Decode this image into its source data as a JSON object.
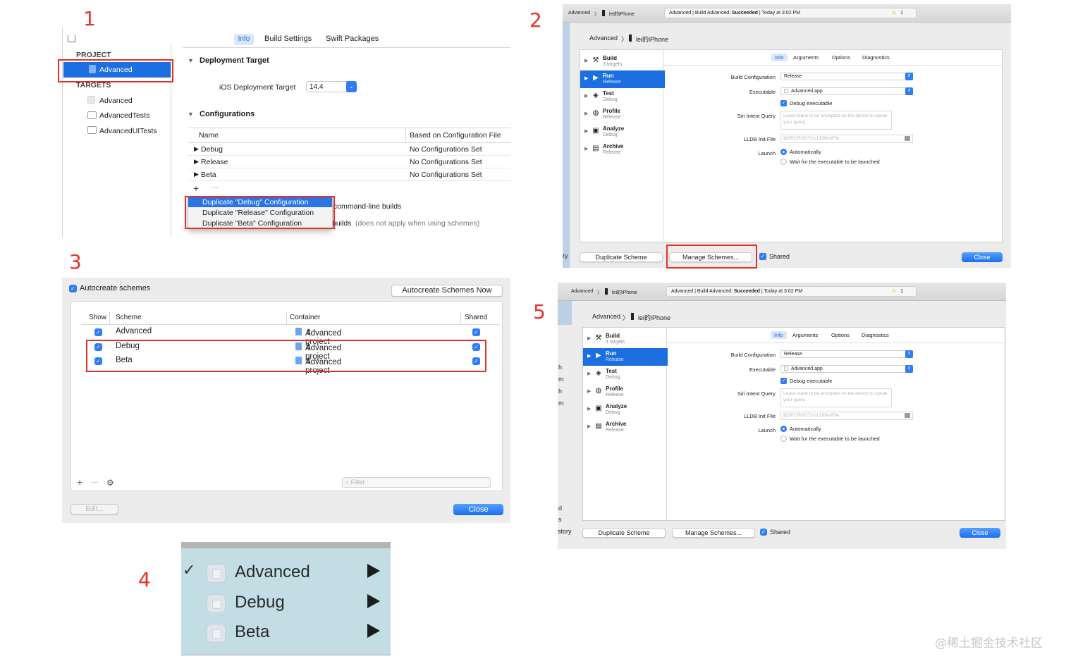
{
  "steps": {
    "s1": "1",
    "s2": "2",
    "s3": "3",
    "s4": "4",
    "s5": "5"
  },
  "panel1": {
    "tabs": [
      "Info",
      "Build Settings",
      "Swift Packages"
    ],
    "project_header": "PROJECT",
    "project_item": "Advanced",
    "targets_header": "TARGETS",
    "targets": [
      "Advanced",
      "AdvancedTests",
      "AdvancedUITests"
    ],
    "deployment_section": "Deployment Target",
    "deployment_label": "iOS Deployment Target",
    "deployment_value": "14.4",
    "configurations_section": "Configurations",
    "col_name": "Name",
    "col_based": "Based on Configuration File",
    "configs": [
      {
        "name": "Debug",
        "file": "No Configurations Set"
      },
      {
        "name": "Release",
        "file": "No Configurations Set"
      },
      {
        "name": "Beta",
        "file": "No Configurations Set"
      }
    ],
    "add": "+",
    "remove": "—",
    "menu": [
      "Duplicate \"Debug\" Configuration",
      "Duplicate \"Release\" Configuration",
      "Duplicate \"Beta\" Configuration"
    ],
    "behind_line1": "command-line builds",
    "behind_line2a": "builds",
    "behind_line2b": "(does not apply when using schemes)"
  },
  "scheme_editor": {
    "crumb_project": "Advanced",
    "crumb_device": "lei的iPhone",
    "status_prefix": "Advanced | Build Advanced: ",
    "status_bold": "Succeeded",
    "status_suffix": " | Today at 3:02 PM",
    "warning_count": "1",
    "actions": [
      {
        "t": "Build",
        "s": "3 targets"
      },
      {
        "t": "Run",
        "s": "Release"
      },
      {
        "t": "Test",
        "s": "Debug"
      },
      {
        "t": "Profile",
        "s": "Release"
      },
      {
        "t": "Analyze",
        "s": "Debug"
      },
      {
        "t": "Archive",
        "s": "Release"
      }
    ],
    "tabs": [
      "Info",
      "Arguments",
      "Options",
      "Diagnostics"
    ],
    "build_config_label": "Build Configuration",
    "build_config_value": "Release",
    "executable_label": "Executable",
    "executable_value": "Advanced.app",
    "debug_executable": "Debug executable",
    "siri_label": "Siri Intent Query",
    "siri_placeholder": "Leave blank to be prompted on the device to speak your query.",
    "lldb_label": "LLDB Init File",
    "lldb_placeholder": "$(SRCROOT)/.LLDBInitFile",
    "launch_label": "Launch",
    "launch_auto": "Automatically",
    "launch_wait": "Wait for the executable to be launched",
    "duplicate_btn": "Duplicate Scheme",
    "manage_btn": "Manage Schemes...",
    "shared": "Shared",
    "close": "Close"
  },
  "panel2_side": {
    "t1": "ry"
  },
  "panel5_side": {
    "letters": [
      "h",
      "m",
      "h",
      "m",
      "d",
      "s",
      "story"
    ]
  },
  "panel3": {
    "autocreate": "Autocreate schemes",
    "autocreate_now": "Autocreate Schemes Now",
    "cols": {
      "show": "Show",
      "scheme": "Scheme",
      "container": "Container",
      "shared": "Shared"
    },
    "rows": [
      {
        "scheme": "Advanced",
        "container": "Advanced project"
      },
      {
        "scheme": "Debug",
        "container": "Advanced project"
      },
      {
        "scheme": "Beta",
        "container": "Advanced project"
      }
    ],
    "filter_placeholder": "Filter",
    "edit": "Edit...",
    "close": "Close",
    "add": "+",
    "remove": "—"
  },
  "panel4": {
    "items": [
      "Advanced",
      "Debug",
      "Beta"
    ],
    "checkmark": "✓"
  },
  "watermark": "@稀土掘金技术社区"
}
